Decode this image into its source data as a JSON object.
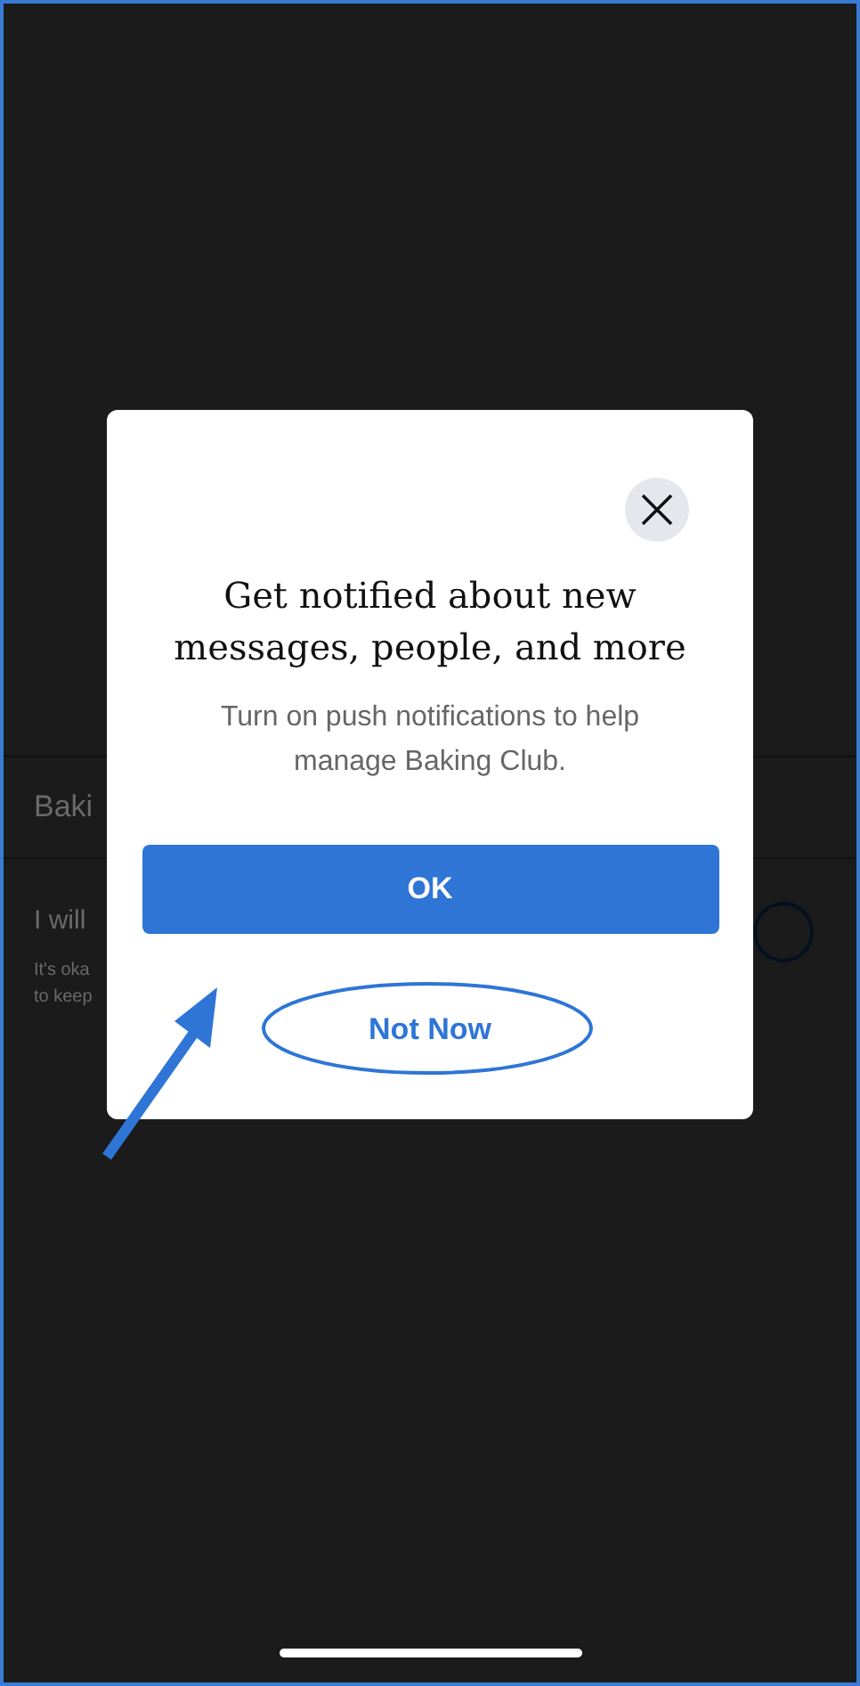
{
  "background": {
    "group_name": "Baki",
    "post_title": "I will",
    "post_body": [
      "It's oka",
      "to keep"
    ],
    "toggle": {
      "on": false
    }
  },
  "dialog": {
    "title": "Get notified about new messages, people, and more",
    "message": "Turn on push notifications to help manage Baking Club.",
    "buttons": [
      {
        "label": "OK",
        "kind": "primary"
      },
      {
        "label": "Not Now",
        "kind": "link"
      }
    ]
  }
}
